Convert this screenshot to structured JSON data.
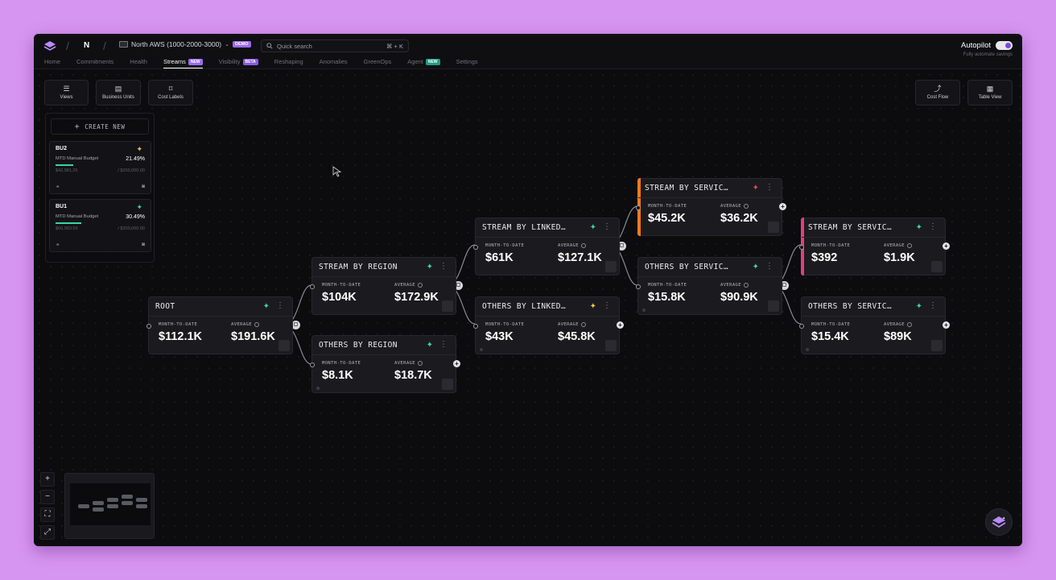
{
  "header": {
    "org": "N",
    "account": "North AWS (1000-2000-3000)",
    "account_badge": "DEMO",
    "search_placeholder": "Quick search",
    "search_shortcut": "⌘ + K",
    "autopilot_label": "Autopilot",
    "autopilot_sub": "Fully automate savings",
    "autopilot_on": true
  },
  "nav": [
    {
      "label": "Home",
      "badge": ""
    },
    {
      "label": "Commitments",
      "badge": ""
    },
    {
      "label": "Health",
      "badge": ""
    },
    {
      "label": "Streams",
      "badge": "NEW",
      "active": true
    },
    {
      "label": "Visibility",
      "badge": "BETA"
    },
    {
      "label": "Reshaping",
      "badge": ""
    },
    {
      "label": "Anomalies",
      "badge": ""
    },
    {
      "label": "GreenOps",
      "badge": ""
    },
    {
      "label": "Agent",
      "badge": "NEW"
    },
    {
      "label": "Settings",
      "badge": ""
    }
  ],
  "toolbar": {
    "views": "Views",
    "business_units": "Business Units",
    "cost_labels": "Cost Labels",
    "cost_flow": "Cost Flow",
    "table_view": "Table View"
  },
  "bu_panel": {
    "create_new": "CREATE NEW",
    "cards": [
      {
        "name": "BU2",
        "budget_label": "MTD Manual Budget",
        "pct": "21.49%",
        "spent": "$42,981.25",
        "total": "/ $200,000.00"
      },
      {
        "name": "BU1",
        "budget_label": "MTD Manual Budget",
        "pct": "30.49%",
        "spent": "$60,983.59",
        "total": "/ $200,000.00"
      }
    ]
  },
  "labels": {
    "mtd": "MONTH-TO-DATE",
    "avg": "AVERAGE"
  },
  "nodes": {
    "root": {
      "title": "ROOT",
      "mtd": "$112.1K",
      "avg": "$191.6K"
    },
    "stream_region": {
      "title": "STREAM BY REGION",
      "mtd": "$104K",
      "avg": "$172.9K"
    },
    "others_region": {
      "title": "OTHERS BY REGION",
      "mtd": "$8.1K",
      "avg": "$18.7K"
    },
    "stream_linked": {
      "title": "STREAM BY LINKED…",
      "mtd": "$61K",
      "avg": "$127.1K"
    },
    "others_linked": {
      "title": "OTHERS BY LINKED…",
      "mtd": "$43K",
      "avg": "$45.8K"
    },
    "stream_service_1": {
      "title": "STREAM BY SERVIC…",
      "mtd": "$45.2K",
      "avg": "$36.2K"
    },
    "others_service_1": {
      "title": "OTHERS BY SERVIC…",
      "mtd": "$15.8K",
      "avg": "$90.9K"
    },
    "stream_service_2": {
      "title": "STREAM BY SERVIC…",
      "mtd": "$392",
      "avg": "$1.9K"
    },
    "others_service_2": {
      "title": "OTHERS BY SERVIC…",
      "mtd": "$15.4K",
      "avg": "$89K"
    }
  },
  "colors": {
    "accent": "#9b6bf0",
    "orange_bar": "#f07a1a",
    "pink_bar": "#e0407f",
    "spark_teal": "#3bd3a6",
    "spark_gold": "#f2c14e",
    "spark_red": "#e5484d"
  },
  "zoom": {
    "in": "+",
    "out": "−"
  }
}
